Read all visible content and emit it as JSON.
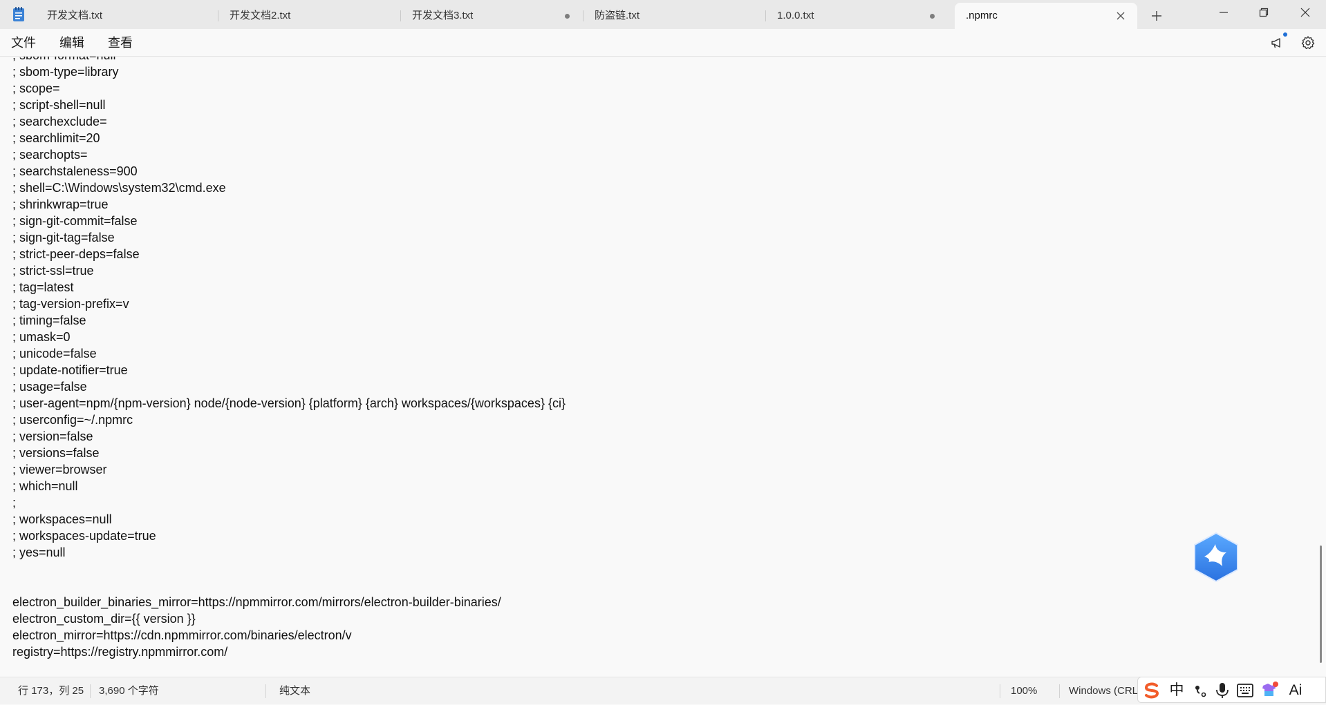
{
  "tabs": [
    {
      "label": "开发文档.txt",
      "modified": false,
      "active": false
    },
    {
      "label": "开发文档2.txt",
      "modified": false,
      "active": false
    },
    {
      "label": "开发文档3.txt",
      "modified": true,
      "active": false
    },
    {
      "label": "防盗链.txt",
      "modified": false,
      "active": false
    },
    {
      "label": "1.0.0.txt",
      "modified": true,
      "active": false
    },
    {
      "label": ".npmrc",
      "modified": false,
      "active": true
    }
  ],
  "menu": {
    "file": "文件",
    "edit": "编辑",
    "view": "查看"
  },
  "editor": {
    "lines": [
      "; sbom-format=null",
      "; sbom-type=library",
      "; scope=",
      "; script-shell=null",
      "; searchexclude=",
      "; searchlimit=20",
      "; searchopts=",
      "; searchstaleness=900",
      "; shell=C:\\Windows\\system32\\cmd.exe",
      "; shrinkwrap=true",
      "; sign-git-commit=false",
      "; sign-git-tag=false",
      "; strict-peer-deps=false",
      "; strict-ssl=true",
      "; tag=latest",
      "; tag-version-prefix=v",
      "; timing=false",
      "; umask=0",
      "; unicode=false",
      "; update-notifier=true",
      "; usage=false",
      "; user-agent=npm/{npm-version} node/{node-version} {platform} {arch} workspaces/{workspaces} {ci}",
      "; userconfig=~/.npmrc",
      "; version=false",
      "; versions=false",
      "; viewer=browser",
      "; which=null",
      ";",
      "; workspaces=null",
      "; workspaces-update=true",
      "; yes=null",
      "",
      "",
      "electron_builder_binaries_mirror=https://npmmirror.com/mirrors/electron-builder-binaries/",
      "electron_custom_dir={{ version }}",
      "electron_mirror=https://cdn.npmmirror.com/binaries/electron/v",
      "registry=https://registry.npmmirror.com/"
    ]
  },
  "status": {
    "position": "行 173，列 25",
    "char_count": "3,690 个字符",
    "format": "纯文本",
    "zoom": "100%",
    "line_ending": "Windows (CRLF)"
  },
  "ime": {
    "chinese": "中",
    "ai": "Ai"
  },
  "icons": {
    "app": "notepad-icon",
    "close": "close-icon",
    "new_tab": "plus-icon",
    "announce": "megaphone-icon",
    "settings": "gear-icon",
    "floating": "bird-assistant-icon"
  },
  "colors": {
    "accent": "#1f6fd6",
    "ime_brand": "#f25c2a",
    "bird_blue": "#3d8ff0"
  }
}
